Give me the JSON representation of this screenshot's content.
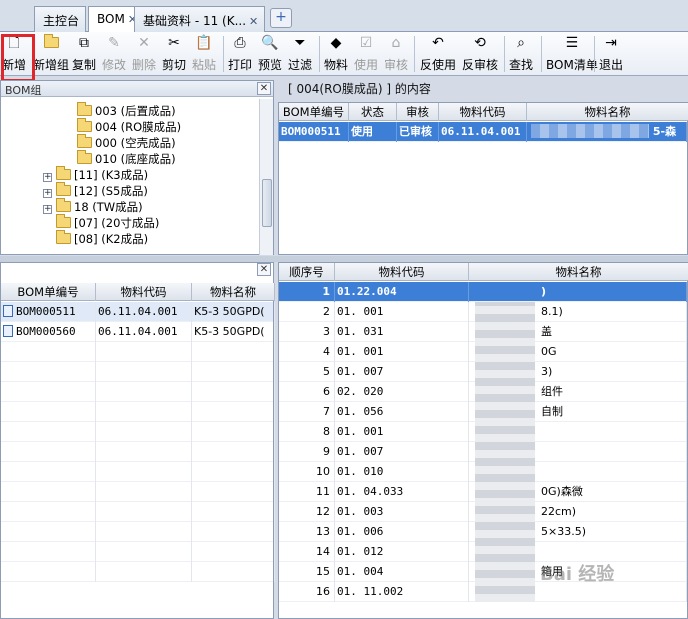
{
  "tabs": [
    {
      "label": "主控台",
      "closable": false,
      "active": false
    },
    {
      "label": "BOM",
      "closable": true,
      "active": true
    },
    {
      "label": "基础资料 - 11 (K...",
      "closable": true,
      "active": false
    }
  ],
  "toolbar": {
    "new": "新增",
    "new_group": "新增组",
    "copy": "复制",
    "modify": "修改",
    "delete": "删除",
    "cut": "剪切",
    "paste": "粘贴",
    "print": "打印",
    "preview": "预览",
    "filter": "过滤",
    "material": "物料",
    "use": "使用",
    "audit": "审核",
    "unuse": "反使用",
    "unaudit": "反审核",
    "find": "查找",
    "bom_list": "BOM清单",
    "exit": "退出"
  },
  "tree_panel": {
    "title": "BOM组",
    "items": [
      {
        "label": "003 (后置成品)",
        "indent": 3,
        "expandable": false
      },
      {
        "label": "004 (RO膜成品)",
        "indent": 3,
        "expandable": false
      },
      {
        "label": "000 (空壳成品)",
        "indent": 3,
        "expandable": false
      },
      {
        "label": "010 (底座成品)",
        "indent": 3,
        "expandable": false
      },
      {
        "label": "[11] (K3成品)",
        "indent": 2,
        "expandable": true
      },
      {
        "label": "[12] (S5成品)",
        "indent": 2,
        "expandable": true
      },
      {
        "label": "18 (TW成品)",
        "indent": 2,
        "expandable": true
      },
      {
        "label": "[07] (20寸成品)",
        "indent": 2,
        "expandable": false
      },
      {
        "label": "[08] (K2成品)",
        "indent": 2,
        "expandable": false
      }
    ]
  },
  "caption": "[ 004(RO膜成品) ] 的内容",
  "bom_grid": {
    "columns": [
      "BOM单编号",
      "状态",
      "审核",
      "物料代码",
      "物料名称"
    ],
    "rows": [
      {
        "bom": "BOM000511",
        "status": "使用",
        "audit": "已审核",
        "code": "06.11.04.001",
        "name": "5-森"
      }
    ]
  },
  "bottom_left_grid": {
    "columns": [
      "BOM单编号",
      "物料代码",
      "物料名称"
    ],
    "rows": [
      {
        "bom": "BOM000511",
        "code": "06.11.04.001",
        "name": "K5-3 50GPD("
      },
      {
        "bom": "BOM000560",
        "code": "06.11.04.001",
        "name": "K5-3 50GPD("
      }
    ]
  },
  "detail_grid": {
    "columns": [
      "顺序号",
      "物料代码",
      "物料名称"
    ],
    "rows": [
      {
        "seq": "1",
        "code": "01.22.004",
        "name": ")"
      },
      {
        "seq": "2",
        "code": "01.     001",
        "name": "8.1)"
      },
      {
        "seq": "3",
        "code": "01.     031",
        "name": "盖"
      },
      {
        "seq": "4",
        "code": "01.     001",
        "name": "0G"
      },
      {
        "seq": "5",
        "code": "01.     007",
        "name": "3)"
      },
      {
        "seq": "6",
        "code": "02.     020",
        "name": "组件"
      },
      {
        "seq": "7",
        "code": "01.     056",
        "name": "自制"
      },
      {
        "seq": "8",
        "code": "01.     001",
        "name": ""
      },
      {
        "seq": "9",
        "code": "01.     007",
        "name": ""
      },
      {
        "seq": "10",
        "code": "01.     010",
        "name": ""
      },
      {
        "seq": "11",
        "code": "01.     04.033",
        "name": "0G)森微"
      },
      {
        "seq": "12",
        "code": "01.     003",
        "name": "22cm)"
      },
      {
        "seq": "13",
        "code": "01.     006",
        "name": "5×33.5)"
      },
      {
        "seq": "14",
        "code": "01.     012",
        "name": ""
      },
      {
        "seq": "15",
        "code": "01.     004",
        "name": "箱用"
      },
      {
        "seq": "16",
        "code": "01.     11.002",
        "name": ""
      }
    ]
  },
  "colors": {
    "selection": "#3d7fd6",
    "highlight_box": "#e0262a",
    "folder": "#f6d776"
  },
  "watermark": "Bai 经验"
}
